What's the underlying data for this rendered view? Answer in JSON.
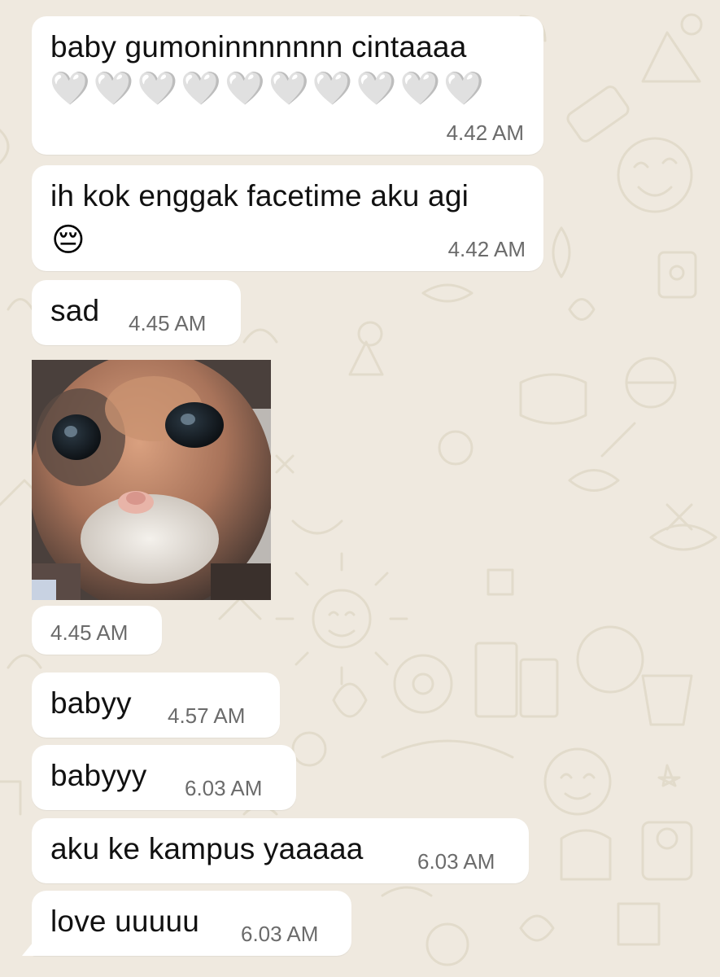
{
  "messages": [
    {
      "text": "baby gumoninnnnnnn cintaaaa",
      "emoji": "🤍🤍🤍🤍🤍🤍🤍🤍🤍🤍",
      "time": "4.42 AM"
    },
    {
      "text": "ih kok enggak facetime aku agi",
      "emoji": "😔",
      "time": "4.42 AM"
    },
    {
      "text": "sad",
      "time": "4.45 AM"
    },
    {
      "image": "kitten-photo",
      "time": "4.45 AM"
    },
    {
      "text": "babyy",
      "time": "4.57 AM"
    },
    {
      "text": "babyyy",
      "time": "6.03 AM"
    },
    {
      "text": "aku ke kampus yaaaaa",
      "time": "6.03 AM"
    },
    {
      "text": "love uuuuu",
      "time": "6.03 AM"
    }
  ],
  "colors": {
    "background": "#efe9df",
    "bubble": "#ffffff",
    "text": "#111111",
    "timestamp": "#6b6b6b",
    "doodle": "#e3dccd"
  },
  "icons": [
    "white-heart-icon",
    "pensive-face-icon"
  ]
}
